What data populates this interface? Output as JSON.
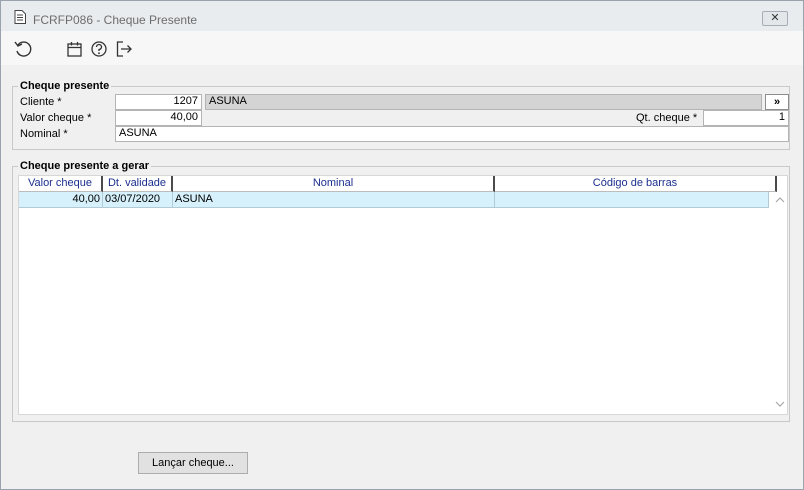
{
  "window": {
    "title": "FCRFP086 - Cheque Presente",
    "close_glyph": "✕"
  },
  "toolbar": {
    "icons": [
      "undo-icon",
      "calendar-icon",
      "help-icon",
      "exit-icon"
    ]
  },
  "cheque_presente": {
    "legend": "Cheque presente",
    "cliente_label": "Cliente *",
    "cliente_code": "1207",
    "cliente_name": "ASUNA",
    "lookup_glyph": "»",
    "valor_label": "Valor cheque *",
    "valor_value": "40,00",
    "qt_label": "Qt. cheque *",
    "qt_value": "1",
    "nominal_label": "Nominal *",
    "nominal_value": "ASUNA"
  },
  "cheque_gerar": {
    "legend": "Cheque presente a gerar",
    "columns": [
      "Valor cheque",
      "Dt. validade",
      "Nominal",
      "Código de barras"
    ],
    "rows": [
      [
        "40,00",
        "03/07/2020",
        "ASUNA",
        ""
      ]
    ],
    "scroll_up": "^",
    "scroll_down": "v"
  },
  "footer": {
    "launch_button": "Lançar cheque..."
  }
}
